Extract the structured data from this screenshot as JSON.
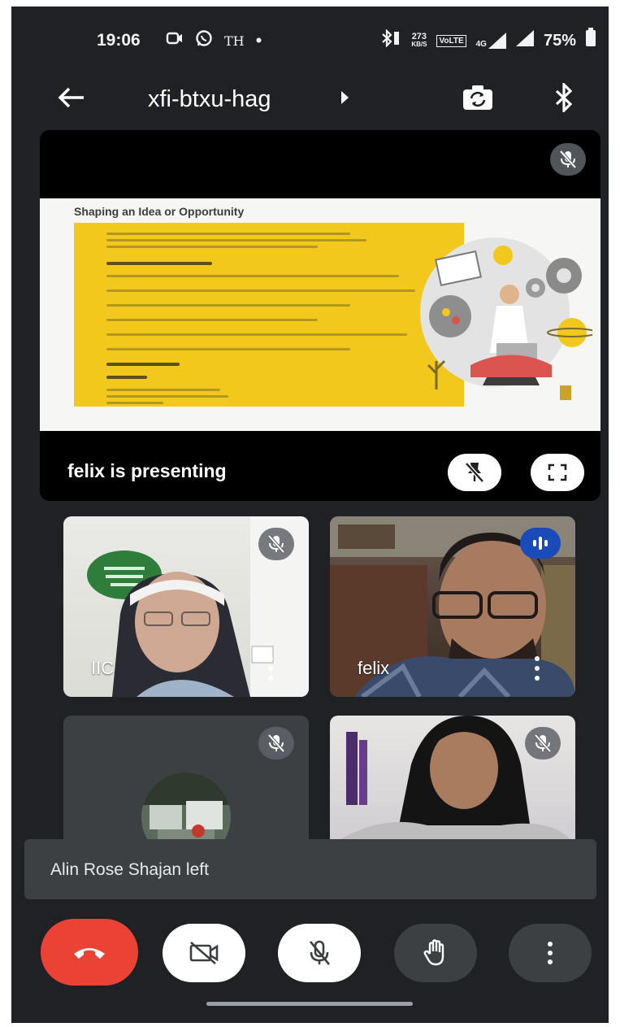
{
  "status_bar": {
    "time": "19:06",
    "left_icons": [
      "screen-record-icon",
      "whatsapp-icon",
      "th-icon",
      "dot-icon"
    ],
    "th_text": "TH",
    "speed_top": "273",
    "speed_bottom": "KB/S",
    "volte": "VoLTE",
    "net": "4G",
    "battery": "75%"
  },
  "top_bar": {
    "meeting_code": "xfi-btxu-hag",
    "back_icon": "arrow-back-icon",
    "switch_camera_icon": "switch-camera-icon",
    "audio_output_icon": "bluetooth-icon"
  },
  "presentation": {
    "label": "felix is presenting",
    "slide_title": "Shaping an Idea or Opportunity",
    "buttons": [
      "unpin-icon",
      "fullscreen-icon"
    ]
  },
  "participants": [
    {
      "name": "IIC",
      "muted": true
    },
    {
      "name": "felix",
      "muted": false,
      "speaking": true
    },
    {
      "name": "",
      "muted": true,
      "camera_off": true
    },
    {
      "name": "",
      "muted": true
    }
  ],
  "toast": {
    "message": "Alin Rose Shajan left"
  },
  "controls": [
    "end-call-icon",
    "camera-off-icon",
    "mic-off-icon",
    "raise-hand-icon",
    "more-options-icon"
  ],
  "colors": {
    "background": "#202124",
    "end_call": "#ea4335",
    "speaking_badge": "#1a4bb8",
    "slide_yellow": "#f2c81c"
  }
}
